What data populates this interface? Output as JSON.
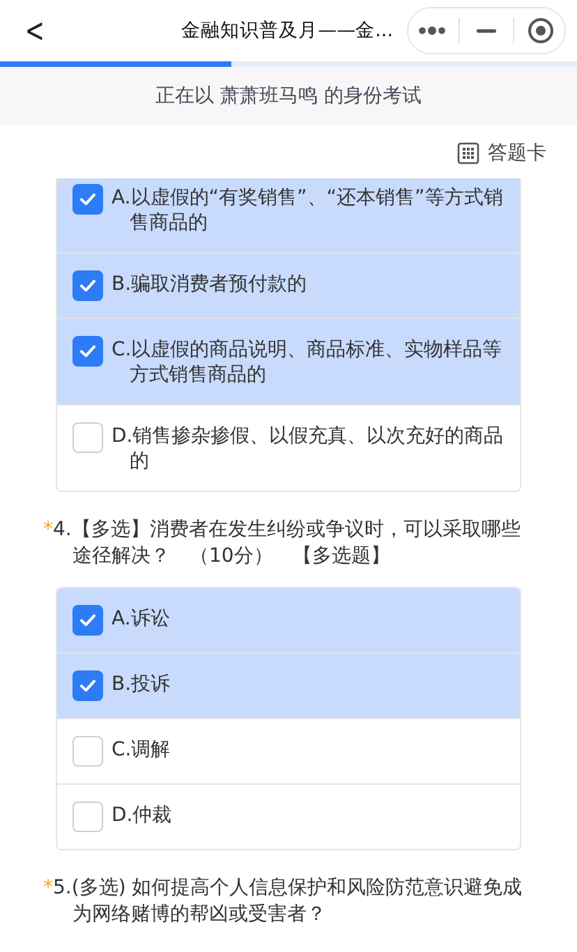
{
  "header": {
    "back": "<",
    "title": "金融知识普及月——金..."
  },
  "progress": {
    "level": 0.4
  },
  "banner": "正在以 萧萧班马鸣 的身份考试",
  "answer_card": {
    "label": "答题卡"
  },
  "questions": [
    {
      "options": [
        {
          "text": "A.以虚假的“有奖销售”、“还本销售”等方式销售商品的",
          "checked": true
        },
        {
          "text": "B.骗取消费者预付款的",
          "checked": true
        },
        {
          "text": "C.以虚假的商品说明、商品标准、实物样品等方式销售商品的",
          "checked": true
        },
        {
          "text": "D.销售掺杂掺假、以假充真、以次充好的商品的",
          "checked": false
        }
      ]
    },
    {
      "marker": "*",
      "title": "4.【多选】消费者在发生纠纷或争议时，可以采取哪些途径解决？　（10分）　【多选题】",
      "options": [
        {
          "text": "A.诉讼",
          "checked": true
        },
        {
          "text": "B.投诉",
          "checked": true
        },
        {
          "text": "C.调解",
          "checked": false
        },
        {
          "text": "D.仲裁",
          "checked": false
        }
      ]
    },
    {
      "marker": "*",
      "title": "5.(多选) 如何提高个人信息保护和风险防范意识避免成为网络赌博的帮凶或受害者？"
    }
  ]
}
